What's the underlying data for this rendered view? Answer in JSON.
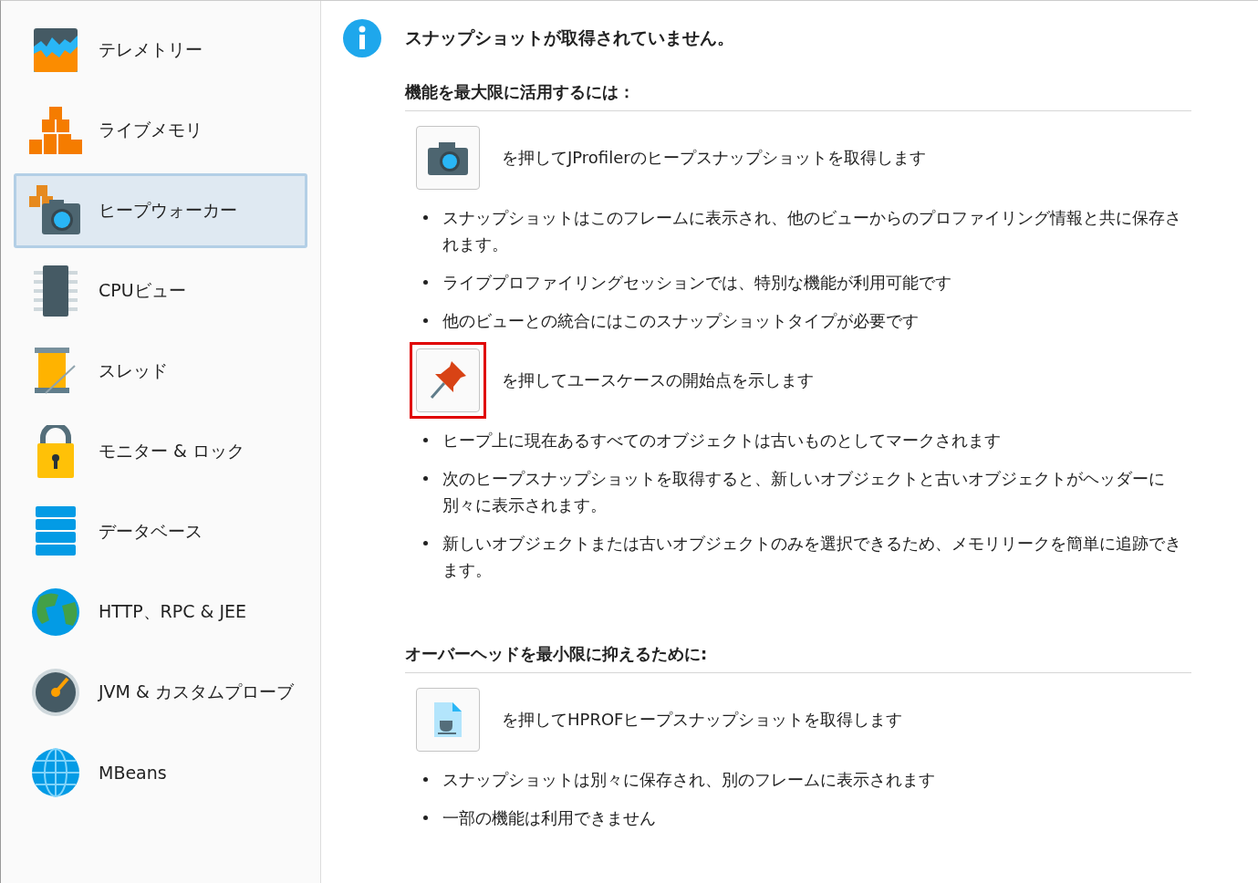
{
  "sidebar": {
    "items": [
      {
        "label": "テレメトリー",
        "kind": "telemetry",
        "selected": false
      },
      {
        "label": "ライブメモリ",
        "kind": "blocks",
        "selected": false
      },
      {
        "label": "ヒープウォーカー",
        "kind": "heap",
        "selected": true
      },
      {
        "label": "CPUビュー",
        "kind": "chip",
        "selected": false
      },
      {
        "label": "スレッド",
        "kind": "spool",
        "selected": false
      },
      {
        "label": "モニター & ロック",
        "kind": "lock",
        "selected": false
      },
      {
        "label": "データベース",
        "kind": "database",
        "selected": false
      },
      {
        "label": "HTTP、RPC & JEE",
        "kind": "earth",
        "selected": false
      },
      {
        "label": "JVM & カスタムプローブ",
        "kind": "gauge",
        "selected": false
      },
      {
        "label": "MBeans",
        "kind": "globe",
        "selected": false
      }
    ]
  },
  "main": {
    "title": "スナップショットが取得されていません。",
    "sections": [
      {
        "heading": "機能を最大限に活用するには：",
        "actions": [
          {
            "kind": "camera",
            "text": "を押してJProfilerのヒープスナップショットを取得します",
            "highlighted": false,
            "bullets": [
              "スナップショットはこのフレームに表示され、他のビューからのプロファイリング情報と共に保存されます。",
              "ライブプロファイリングセッションでは、特別な機能が利用可能です",
              "他のビューとの統合にはこのスナップショットタイプが必要です"
            ]
          },
          {
            "kind": "pin",
            "text": "を押してユースケースの開始点を示します",
            "highlighted": true,
            "bullets": [
              "ヒープ上に現在あるすべてのオブジェクトは古いものとしてマークされます",
              "次のヒープスナップショットを取得すると、新しいオブジェクトと古いオブジェクトがヘッダーに別々に表示されます。",
              "新しいオブジェクトまたは古いオブジェクトのみを選択できるため、メモリリークを簡単に追跡できます。"
            ]
          }
        ]
      },
      {
        "heading": "オーバーヘッドを最小限に抑えるために:",
        "actions": [
          {
            "kind": "hprof",
            "text": "を押してHPROFヒープスナップショットを取得します",
            "highlighted": false,
            "bullets": [
              "スナップショットは別々に保存され、別のフレームに表示されます",
              "一部の機能は利用できません"
            ]
          }
        ]
      }
    ]
  }
}
